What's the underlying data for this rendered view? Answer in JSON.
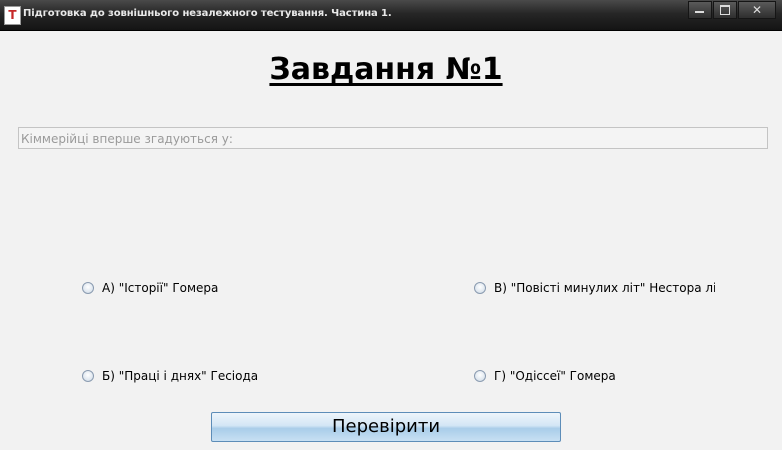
{
  "window": {
    "title": "Підготовка до зовнішнього незалежного тестування. Частина 1.",
    "icon_letter": "T",
    "close_glyph": "✕"
  },
  "task": {
    "heading": "Завдання №1",
    "question": "Кіммерійці вперше згадуються у:"
  },
  "options": [
    {
      "label": "А) \"Історії\" Гомера"
    },
    {
      "label": "В) \"Повісті минулих літ\" Нестора літопи"
    },
    {
      "label": "Б) \"Праці і днях\" Гесіода"
    },
    {
      "label": "Г) \"Одіссеї\" Гомера"
    }
  ],
  "actions": {
    "check_label": "Перевірити"
  },
  "colors": {
    "titlebar": "#262626",
    "background": "#f2f2f2",
    "button_border": "#5d8db8",
    "icon_letter": "#c62828"
  }
}
